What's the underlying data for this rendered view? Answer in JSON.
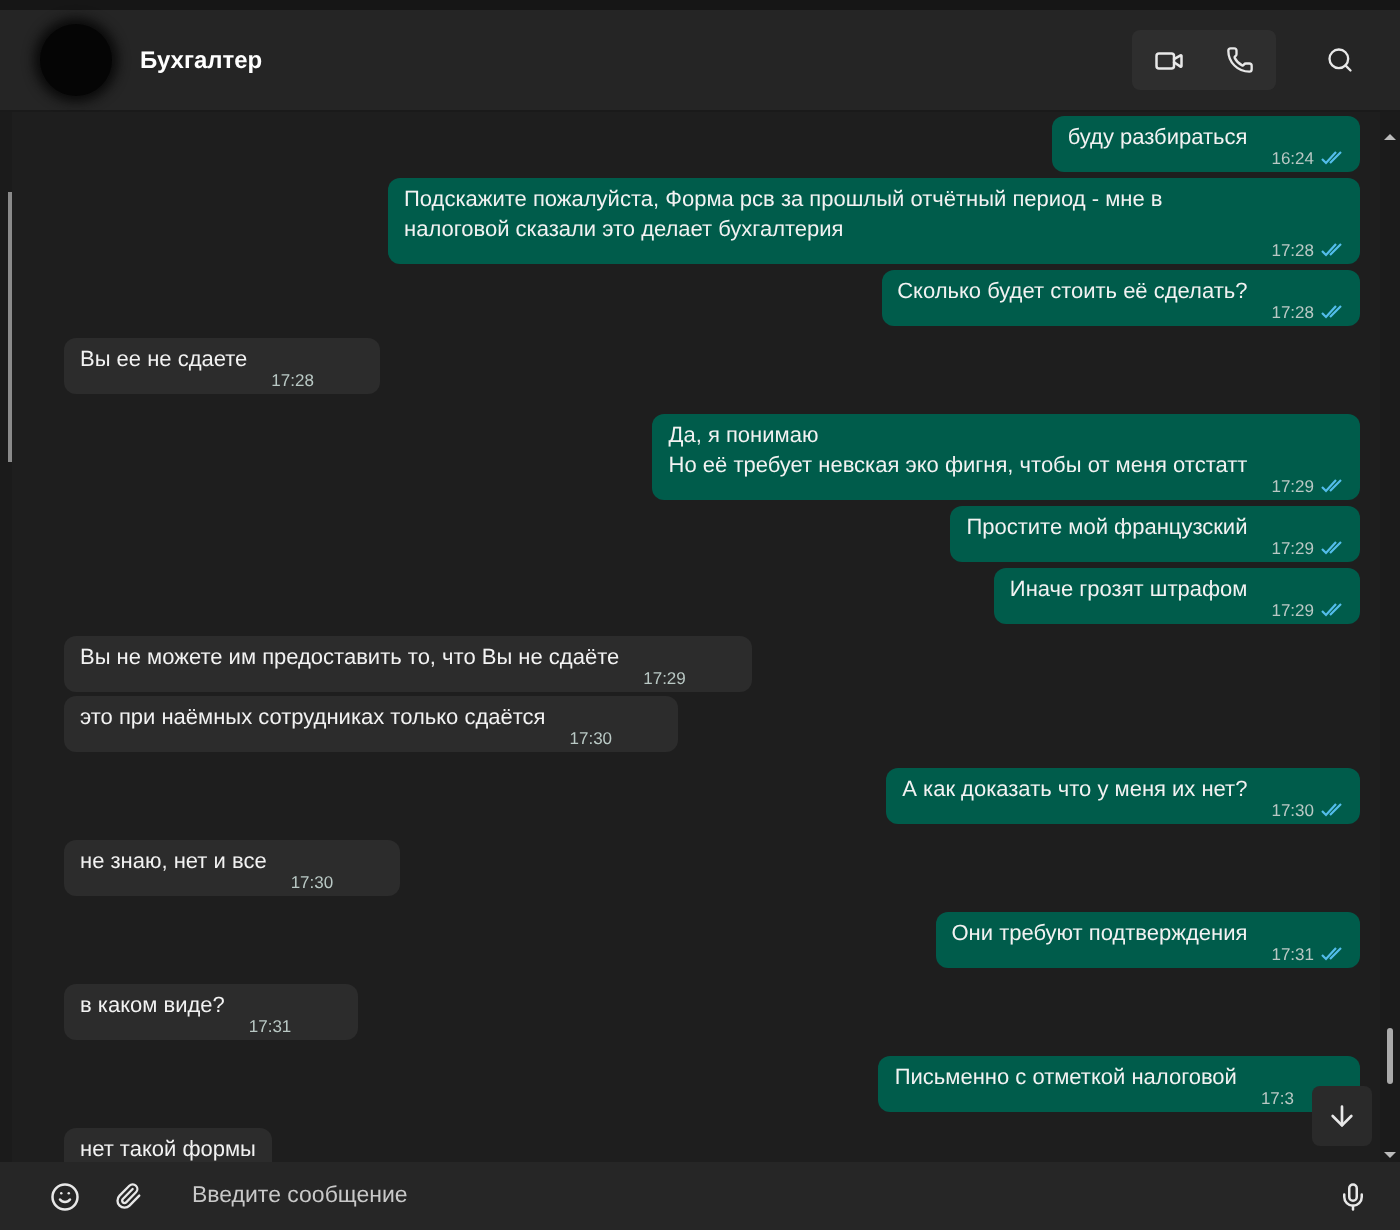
{
  "header": {
    "contact": "Бухгалтер"
  },
  "messages": [
    {
      "kind": "out",
      "text": "буду разбираться",
      "time": "16:24",
      "read": true
    },
    {
      "kind": "out",
      "text": "Подскажите пожалуйста, Форма рсв за прошлый отчётный период - мне в налоговой сказали это делает бухгалтерия",
      "time": "17:28",
      "read": true
    },
    {
      "kind": "out",
      "text": "Сколько будет стоить её сделать?",
      "time": "17:28",
      "read": true
    },
    {
      "kind": "in",
      "text": "Вы ее не сдаете",
      "time": "17:28"
    },
    {
      "kind": "out",
      "text": "Да, я понимаю\nНо её требует невская эко фигня, чтобы от меня отстатт",
      "time": "17:29",
      "read": true
    },
    {
      "kind": "out",
      "text": "Простите мой французский",
      "time": "17:29",
      "read": true
    },
    {
      "kind": "out",
      "text": "Иначе грозят штрафом",
      "time": "17:29",
      "read": true
    },
    {
      "kind": "in",
      "text": "Вы не можете им предоставить то, что Вы не сдаёте",
      "time": "17:29"
    },
    {
      "kind": "in",
      "text": "это при наёмных сотрудниках только сдаётся",
      "time": "17:30"
    },
    {
      "kind": "out",
      "text": "А как доказать что у меня их нет?",
      "time": "17:30",
      "read": true
    },
    {
      "kind": "in",
      "text": "не знаю, нет и все",
      "time": "17:30"
    },
    {
      "kind": "out",
      "text": "Они требуют подтверждения",
      "time": "17:31",
      "read": true
    },
    {
      "kind": "in",
      "text": "в каком виде?",
      "time": "17:31"
    },
    {
      "kind": "out",
      "text": "Письменно с отметкой налоговой",
      "time": "17:3"
    },
    {
      "kind": "in",
      "text": "нет такой формы"
    }
  ],
  "composer": {
    "placeholder": "Введите сообщение"
  }
}
